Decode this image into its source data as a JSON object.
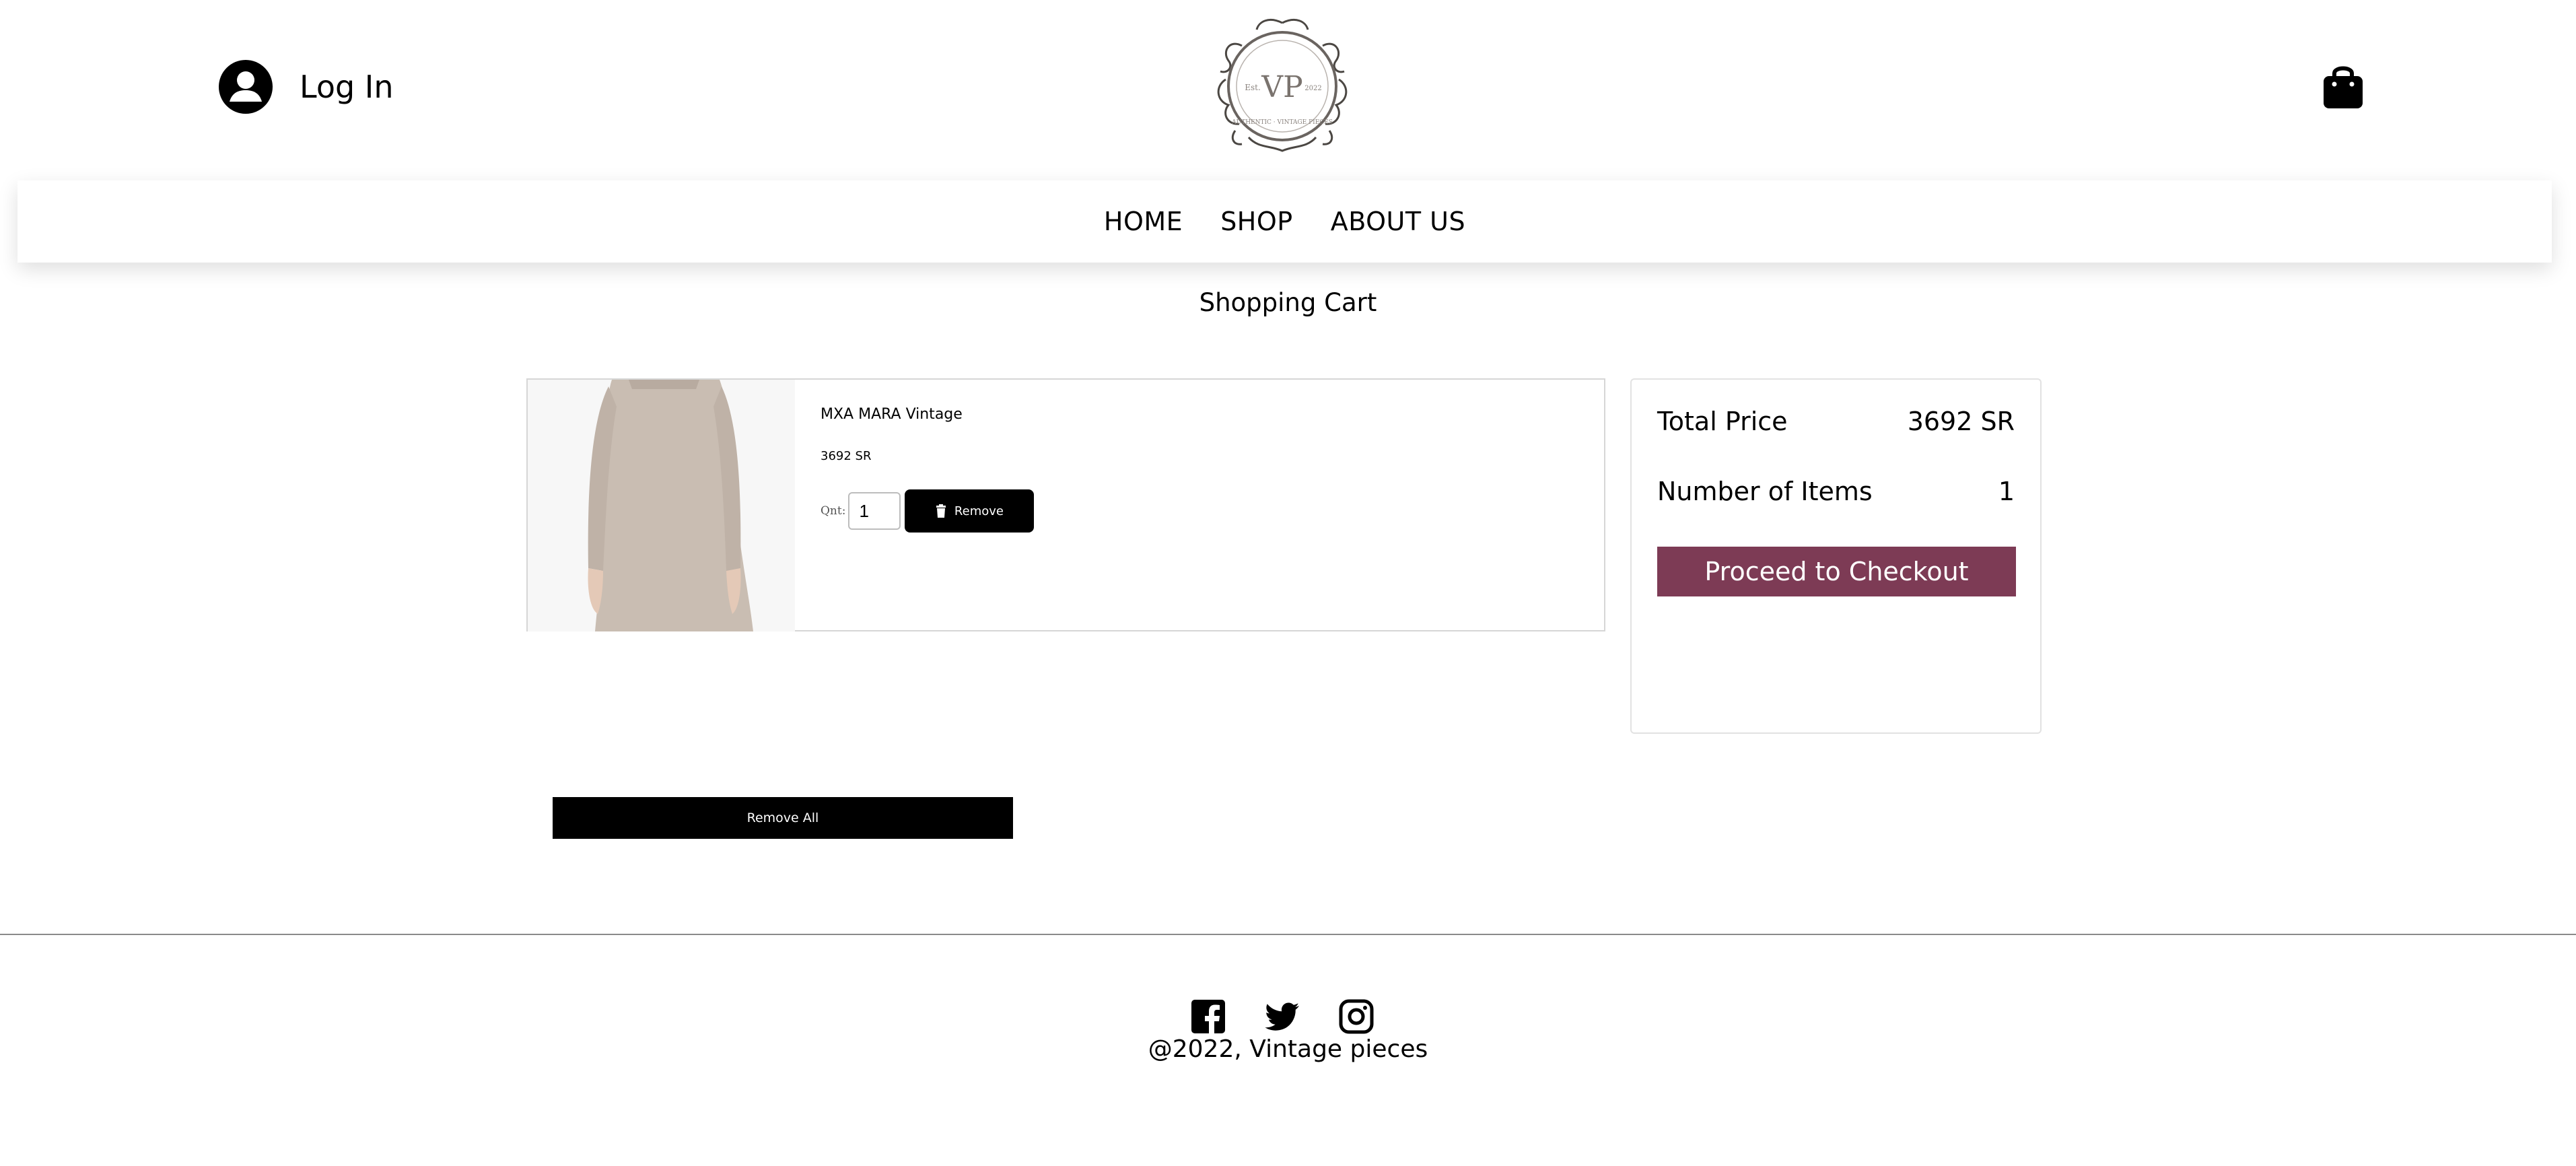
{
  "header": {
    "login_label": "Log In",
    "logo_monogram": "VP",
    "logo_ring_text": "AUTHENTIC · VINTAGE PIECES",
    "logo_est": "Est.",
    "logo_year": "2022"
  },
  "nav": {
    "items": [
      {
        "label": "HOME"
      },
      {
        "label": "SHOP"
      },
      {
        "label": "ABOUT US"
      }
    ]
  },
  "page": {
    "title": "Shopping Cart"
  },
  "cart": {
    "items": [
      {
        "name": "MXA MARA Vintage",
        "price": "3692 SR",
        "qty_label": "Qnt:",
        "qty_value": "1",
        "remove_label": "Remove"
      }
    ],
    "remove_all_label": "Remove All"
  },
  "summary": {
    "total_label": "Total Price",
    "total_value": "3692 SR",
    "count_label": "Number of Items",
    "count_value": "1",
    "checkout_label": "Proceed to Checkout"
  },
  "footer": {
    "copyright": "@2022, Vintage pieces",
    "social_icons": [
      "facebook-icon",
      "twitter-icon",
      "instagram-icon"
    ]
  },
  "colors": {
    "accent": "#7d3b55",
    "button_dark": "#000000",
    "item_image_bg": "#f7f7f7",
    "dress": "#c9bdb2"
  }
}
